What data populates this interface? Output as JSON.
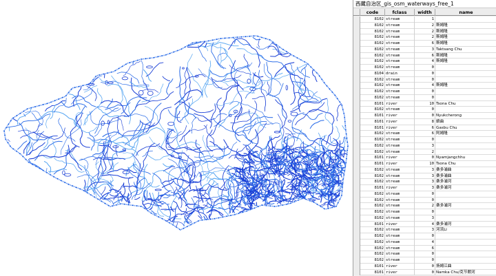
{
  "window_title": "西藏自治区_gis_osm_waterways_free_1",
  "columns": {
    "code": "code",
    "fclass": "fclass",
    "width": "width",
    "name": "name"
  },
  "colors": {
    "river_dark": "#1a3fd6",
    "river_mid": "#2f6fe8",
    "river_light": "#5ba8f2"
  },
  "rows": [
    {
      "code": "8102",
      "fclass": "stream",
      "width": "1",
      "name": ""
    },
    {
      "code": "8102",
      "fclass": "stream",
      "width": "2",
      "name": "斯姆隆"
    },
    {
      "code": "8102",
      "fclass": "stream",
      "width": "2",
      "name": "斯姆隆"
    },
    {
      "code": "8102",
      "fclass": "stream",
      "width": "2",
      "name": "斯姆隆"
    },
    {
      "code": "8102",
      "fclass": "stream",
      "width": "6",
      "name": "斯姆隆"
    },
    {
      "code": "8102",
      "fclass": "stream",
      "width": "3",
      "name": "Taktsang Chu"
    },
    {
      "code": "8102",
      "fclass": "stream",
      "width": "6",
      "name": "斯姆隆"
    },
    {
      "code": "8102",
      "fclass": "stream",
      "width": "4",
      "name": "斯姆隆"
    },
    {
      "code": "8102",
      "fclass": "stream",
      "width": "0",
      "name": ""
    },
    {
      "code": "8104",
      "fclass": "drain",
      "width": "0",
      "name": ""
    },
    {
      "code": "8102",
      "fclass": "stream",
      "width": "0",
      "name": ""
    },
    {
      "code": "8102",
      "fclass": "stream",
      "width": "4",
      "name": "斯姆隆"
    },
    {
      "code": "8102",
      "fclass": "stream",
      "width": "0",
      "name": ""
    },
    {
      "code": "8102",
      "fclass": "stream",
      "width": "0",
      "name": ""
    },
    {
      "code": "8101",
      "fclass": "river",
      "width": "10",
      "name": "Tsona Chu"
    },
    {
      "code": "8102",
      "fclass": "stream",
      "width": "0",
      "name": ""
    },
    {
      "code": "8101",
      "fclass": "river",
      "width": "0",
      "name": "Nyukcherong"
    },
    {
      "code": "8101",
      "fclass": "river",
      "width": "8",
      "name": "娘曲"
    },
    {
      "code": "8101",
      "fclass": "river",
      "width": "6",
      "name": "Gasbu Chu"
    },
    {
      "code": "8102",
      "fclass": "stream",
      "width": "6",
      "name": "阿姆隆"
    },
    {
      "code": "8102",
      "fclass": "stream",
      "width": "0",
      "name": ""
    },
    {
      "code": "8102",
      "fclass": "stream",
      "width": "3",
      "name": ""
    },
    {
      "code": "8102",
      "fclass": "stream",
      "width": "2",
      "name": ""
    },
    {
      "code": "8101",
      "fclass": "river",
      "width": "0",
      "name": "Nyamjangchhu"
    },
    {
      "code": "8101",
      "fclass": "river",
      "width": "10",
      "name": "Tsona Chu"
    },
    {
      "code": "8102",
      "fclass": "stream",
      "width": "3",
      "name": "桑多浦曲"
    },
    {
      "code": "8102",
      "fclass": "stream",
      "width": "3",
      "name": "桑多浦曲"
    },
    {
      "code": "8102",
      "fclass": "stream",
      "width": "3",
      "name": "桑多浦河"
    },
    {
      "code": "8101",
      "fclass": "river",
      "width": "3",
      "name": "桑多浦河"
    },
    {
      "code": "8102",
      "fclass": "stream",
      "width": "0",
      "name": ""
    },
    {
      "code": "8102",
      "fclass": "stream",
      "width": "0",
      "name": ""
    },
    {
      "code": "8102",
      "fclass": "stream",
      "width": "2",
      "name": "桑多浦河"
    },
    {
      "code": "8102",
      "fclass": "stream",
      "width": "0",
      "name": ""
    },
    {
      "code": "8102",
      "fclass": "stream",
      "width": "3",
      "name": ""
    },
    {
      "code": "8101",
      "fclass": "river",
      "width": "4",
      "name": "桑多浦河"
    },
    {
      "code": "8102",
      "fclass": "stream",
      "width": "3",
      "name": "河流Li"
    },
    {
      "code": "8102",
      "fclass": "stream",
      "width": "0",
      "name": ""
    },
    {
      "code": "8102",
      "fclass": "stream",
      "width": "4",
      "name": ""
    },
    {
      "code": "8102",
      "fclass": "stream",
      "width": "6",
      "name": ""
    },
    {
      "code": "8102",
      "fclass": "stream",
      "width": "0",
      "name": ""
    },
    {
      "code": "8102",
      "fclass": "stream",
      "width": "0",
      "name": ""
    },
    {
      "code": "8101",
      "fclass": "river",
      "width": "0",
      "name": "扬姆江曲"
    },
    {
      "code": "8101",
      "fclass": "river",
      "width": "0",
      "name": "Namka Chu/克节朗河"
    }
  ]
}
